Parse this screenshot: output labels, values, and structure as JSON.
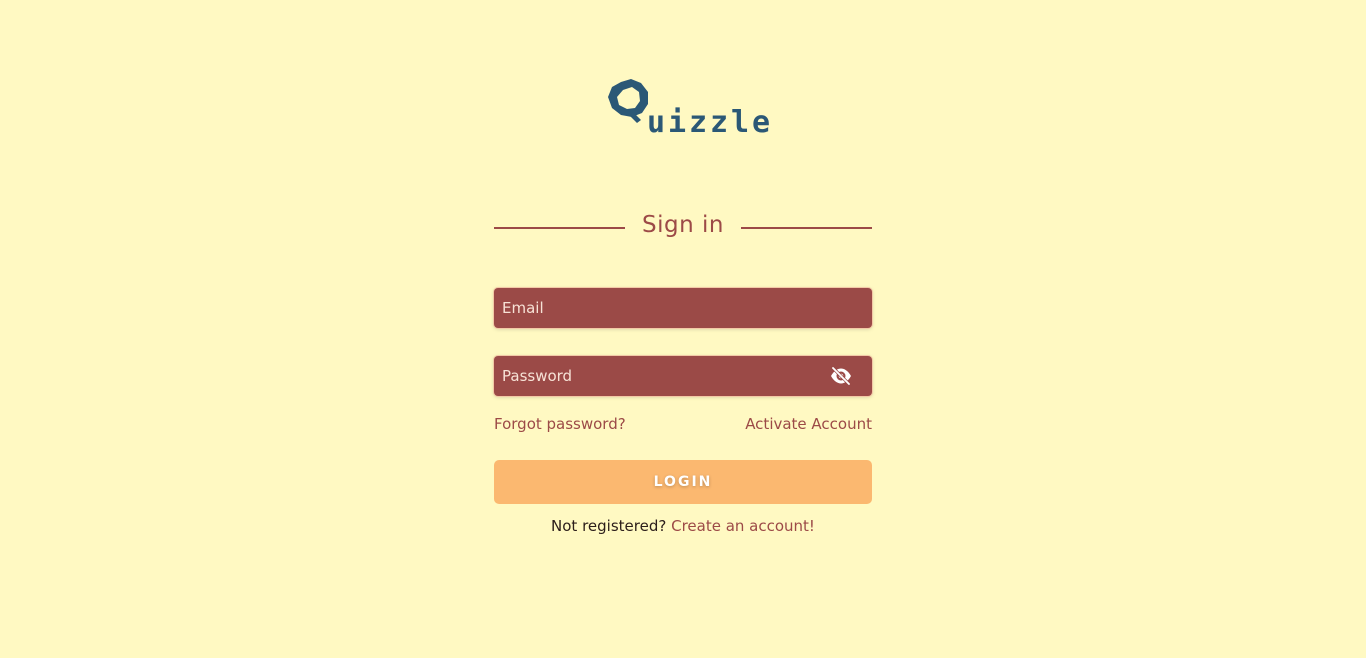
{
  "brand": {
    "logo_text": "Quizzle",
    "logo_color": "#2b5876"
  },
  "signin": {
    "title": "Sign in"
  },
  "form": {
    "email_placeholder": "Email",
    "password_placeholder": "Password",
    "password_toggle_icon": "eye-off-icon"
  },
  "links": {
    "forgot_password": "Forgot password?",
    "activate_account": "Activate Account"
  },
  "actions": {
    "login_label": "LOGIN"
  },
  "register": {
    "prompt": "Not registered?",
    "link": "Create an account!"
  },
  "colors": {
    "background": "#fff9c2",
    "field_bg": "#9b4a47",
    "accent_text": "#9c4a47",
    "button_bg": "#fbb870"
  }
}
